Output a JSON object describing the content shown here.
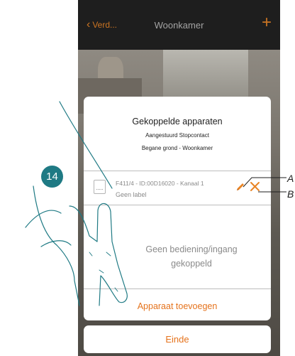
{
  "nav": {
    "back_label": "Verd...",
    "title": "Woonkamer",
    "add_icon": "plus-icon"
  },
  "card": {
    "title": "Gekoppelde apparaten",
    "subtitle": "Aangestuurd Stopcontact",
    "location": "Begane grond - Woonkamer",
    "device": {
      "id_line": "F411/4 - ID:00D16020 - Kanaal 1",
      "label": "Geen label",
      "icon": "socket-icon"
    },
    "no_command_line1": "Geen bediening/ingang",
    "no_command_line2": "gekoppeld",
    "add_button": "Apparaat toevoegen"
  },
  "finish_button": "Einde",
  "annotations": {
    "step": "14",
    "callout_a": "A",
    "callout_b": "B"
  },
  "colors": {
    "accent": "#e5731d",
    "badge": "#1f7a84",
    "topbar": "#1e1e1e"
  }
}
